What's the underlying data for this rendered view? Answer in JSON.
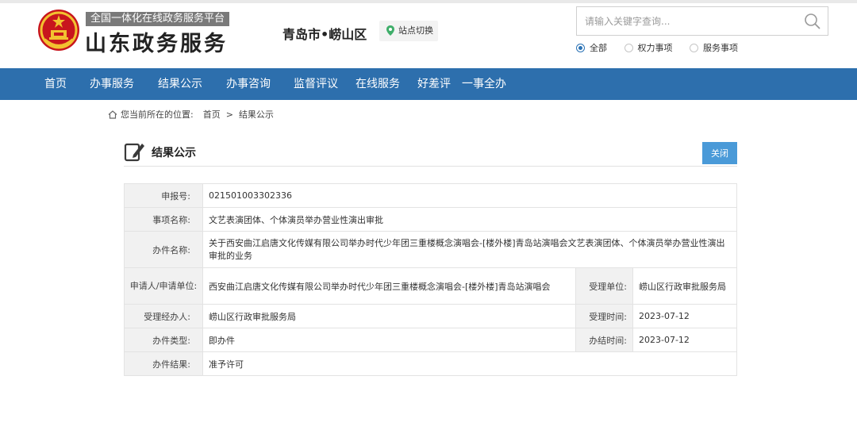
{
  "header": {
    "platform_tag": "全国一体化在线政务服务平台",
    "site_title": "山东政务服务",
    "location": "青岛市•崂山区",
    "station_switch": "站点切换",
    "search": {
      "placeholder": "请输入关键字查询..."
    },
    "scopes": [
      {
        "label": "全部",
        "selected": true
      },
      {
        "label": "权力事项",
        "selected": false
      },
      {
        "label": "服务事项",
        "selected": false
      }
    ]
  },
  "nav": {
    "items": [
      {
        "label": "首页"
      },
      {
        "label": "办事服务"
      },
      {
        "label": "结果公示"
      },
      {
        "label": "办事咨询"
      },
      {
        "label": "监督评议"
      },
      {
        "label": "在线服务"
      },
      {
        "label": "好差评"
      },
      {
        "label": "一事全办"
      }
    ]
  },
  "breadcrumb": {
    "prefix": "您当前所在的位置:",
    "home": "首页",
    "separator": ">",
    "current": "结果公示"
  },
  "panel": {
    "title": "结果公示",
    "close_label": "关闭"
  },
  "record": {
    "application_no_label": "申报号:",
    "application_no": "021501003302336",
    "item_name_label": "事项名称:",
    "item_name": "文艺表演团体、个体演员举办营业性演出审批",
    "case_name_label": "办件名称:",
    "case_name": "关于西安曲江启唐文化传媒有限公司举办时代少年团三重楼概念演唱会-[楼外楼]青岛站演唱会文艺表演团体、个体演员举办营业性演出审批的业务",
    "applicant_label": "申请人/申请单位:",
    "applicant": "西安曲江启唐文化传媒有限公司举办时代少年团三重楼概念演唱会-[楼外楼]青岛站演唱会",
    "accepting_unit_label": "受理单位:",
    "accepting_unit": "崂山区行政审批服务局",
    "handler_label": "受理经办人:",
    "handler": "崂山区行政审批服务局",
    "accept_time_label": "受理时间:",
    "accept_time": "2023-07-12",
    "case_type_label": "办件类型:",
    "case_type": "即办件",
    "finish_time_label": "办结时间:",
    "finish_time": "2023-07-12",
    "result_label": "办件结果:",
    "result": "准予许可"
  },
  "colors": {
    "nav_bg": "#2d6fad",
    "close_button": "#4a9ad8",
    "emblem_red": "#c8161d",
    "emblem_gold": "#f2c230"
  }
}
